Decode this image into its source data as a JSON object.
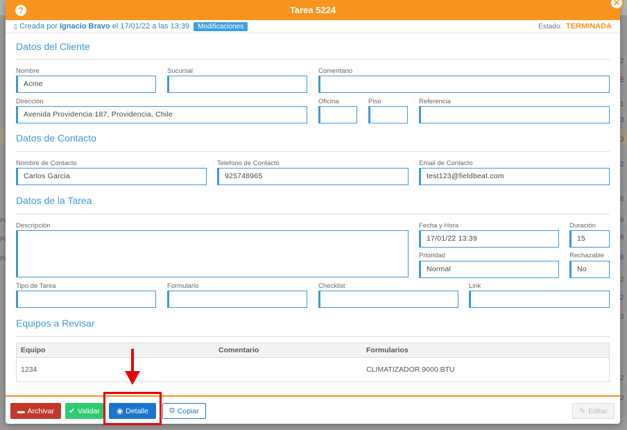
{
  "modal": {
    "title": "Tarea 5224",
    "meta": {
      "created_prefix": "Creada por",
      "created_by": "Ignacio Bravo",
      "created_date": "el 17/01/22 a las 13:39",
      "changes_badge": "Modificaciones",
      "status_label": "Estado:",
      "status_value": "TERMINADA"
    }
  },
  "client": {
    "section_title": "Datos del Cliente",
    "name_label": "Nombre",
    "name_value": "Acme",
    "branch_label": "Sucursal",
    "branch_value": "",
    "comment_label": "Comentario",
    "comment_value": "",
    "address_label": "Dirección",
    "address_value": "Avenida Providencia 187, Providencia, Chile",
    "office_label": "Oficina",
    "office_value": "",
    "floor_label": "Piso",
    "floor_value": "",
    "reference_label": "Referencia",
    "reference_value": ""
  },
  "contact": {
    "section_title": "Datos de Contacto",
    "name_label": "Nombre de Contacto",
    "name_value": "Carlos Garcia",
    "phone_label": "Telefono de Contacto",
    "phone_value": "925748965",
    "email_label": "Email de Contacto",
    "email_value": "test123@fieldbeat.com"
  },
  "task": {
    "section_title": "Datos de la Tarea",
    "description_label": "Descripción",
    "description_value": "",
    "datetime_label": "Fecha y Hora",
    "datetime_value": "17/01/22 13:39",
    "duration_label": "Duración",
    "duration_value": "15",
    "priority_label": "Prioridad",
    "priority_value": "Normal",
    "rejectable_label": "Rechazable",
    "rejectable_value": "No",
    "type_label": "Tipo de Tarea",
    "type_value": "",
    "form_label": "Formulario",
    "form_value": "",
    "checklist_label": "Checklist",
    "checklist_value": "",
    "link_label": "Link",
    "link_value": ""
  },
  "equipment": {
    "section_title": "Equipos a Revisar",
    "headers": [
      "Equipo",
      "Comentario",
      "Formularios"
    ],
    "rows": [
      [
        "1234",
        "",
        "CLIMATIZADOR 9000 BTU"
      ]
    ]
  },
  "footer": {
    "archive": "Archivar",
    "validate": "Validar",
    "detail": "Detalle",
    "copy": "Copiar",
    "edit": "Editar"
  },
  "background": {
    "right_numbers": [
      "2",
      "E",
      "1",
      "3",
      "3",
      "2",
      "6",
      "6",
      "6",
      "6",
      "2",
      "2",
      "3",
      "2",
      "2"
    ],
    "left_letters": [
      "Pu",
      "Pu",
      "Pu"
    ]
  },
  "colors": {
    "accent": "#f7941d",
    "primary": "#1a75cf",
    "danger": "#c0392b",
    "success": "#2ecc71",
    "field_border": "#3b9ad7"
  }
}
